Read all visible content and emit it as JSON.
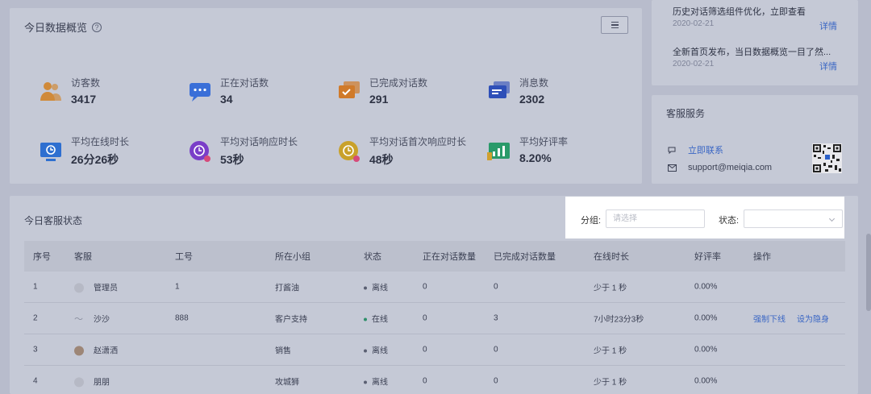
{
  "overview": {
    "title": "今日数据概览",
    "help_glyph": "?",
    "stats": [
      {
        "label": "访客数",
        "value": "3417",
        "icon": "visitors-icon",
        "color": "#d08a3a"
      },
      {
        "label": "正在对话数",
        "value": "34",
        "icon": "chat-bubble-icon",
        "color": "#3a6fd8"
      },
      {
        "label": "已完成对话数",
        "value": "291",
        "icon": "completed-chat-icon",
        "color": "#d07a2a"
      },
      {
        "label": "消息数",
        "value": "2302",
        "icon": "message-icon",
        "color": "#2e4fb8"
      },
      {
        "label": "平均在线时长",
        "value": "26分26秒",
        "icon": "monitor-clock-icon",
        "color": "#2e6fd0"
      },
      {
        "label": "平均对话响应时长",
        "value": "53秒",
        "icon": "purple-clock-icon",
        "color": "#7a3ec8"
      },
      {
        "label": "平均对话首次响应时长",
        "value": "48秒",
        "icon": "yellow-clock-icon",
        "color": "#c9a12a"
      },
      {
        "label": "平均好评率",
        "value": "8.20%",
        "icon": "chart-up-icon",
        "color": "#2a9a6a"
      }
    ]
  },
  "news": {
    "items": [
      {
        "title": "历史对话筛选组件优化，立即查看",
        "date": "2020-02-21",
        "link": "详情"
      },
      {
        "title": "全新首页发布，当日数据概览一目了然...",
        "date": "2020-02-21",
        "link": "详情"
      }
    ]
  },
  "service": {
    "title": "客服服务",
    "contact_link": "立即联系",
    "email": "support@meiqia.com"
  },
  "status": {
    "title": "今日客服状态",
    "filters": {
      "group_label": "分组:",
      "group_placeholder": "请选择",
      "state_label": "状态:",
      "state_value": ""
    },
    "columns": [
      "序号",
      "客服",
      "工号",
      "所在小组",
      "状态",
      "正在对话数量",
      "已完成对话数量",
      "在线时长",
      "好评率",
      "操作"
    ],
    "rows": [
      {
        "no": "1",
        "name": "管理员",
        "avatar": "default",
        "id": "1",
        "group": "打酱油",
        "state": "离线",
        "state_color": "#5a5f72",
        "active": "0",
        "done": "0",
        "online": "少于 1 秒",
        "rate": "0.00%",
        "ops": []
      },
      {
        "no": "2",
        "name": "沙沙",
        "avatar": "wave",
        "id": "888",
        "group": "客户支持",
        "state": "在线",
        "state_color": "#2e8f6a",
        "active": "0",
        "done": "3",
        "online": "7小时23分3秒",
        "rate": "0.00%",
        "ops": [
          "强制下线",
          "设为隐身"
        ]
      },
      {
        "no": "3",
        "name": "赵潇洒",
        "avatar": "photo",
        "id": "",
        "group": "销售",
        "state": "离线",
        "state_color": "#5a5f72",
        "active": "0",
        "done": "0",
        "online": "少于 1 秒",
        "rate": "0.00%",
        "ops": []
      },
      {
        "no": "4",
        "name": "朋朋",
        "avatar": "default",
        "id": "",
        "group": "攻城狮",
        "state": "离线",
        "state_color": "#5a5f72",
        "active": "0",
        "done": "0",
        "online": "少于 1 秒",
        "rate": "0.00%",
        "ops": []
      }
    ]
  }
}
